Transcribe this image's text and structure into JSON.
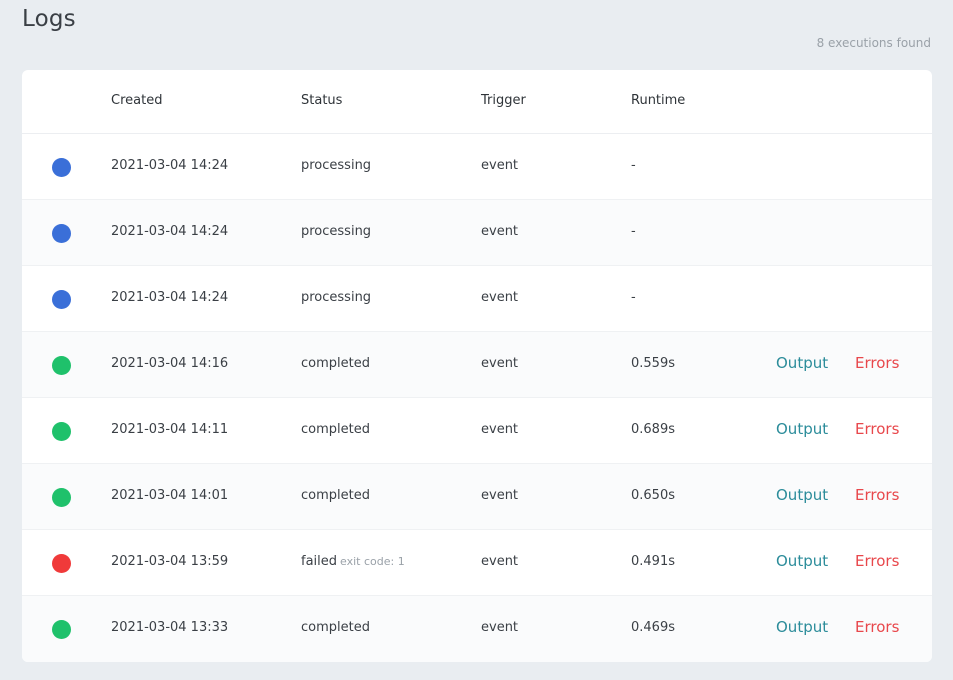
{
  "page": {
    "title": "Logs",
    "count_text": "8 executions found"
  },
  "table": {
    "headers": {
      "created": "Created",
      "status": "Status",
      "trigger": "Trigger",
      "runtime": "Runtime"
    },
    "rows": [
      {
        "status_color": "#3a6fd8",
        "created": "2021-03-04 14:24",
        "status": "processing",
        "exit": "",
        "trigger": "event",
        "runtime": "-",
        "output": "",
        "errors": ""
      },
      {
        "status_color": "#3a6fd8",
        "created": "2021-03-04 14:24",
        "status": "processing",
        "exit": "",
        "trigger": "event",
        "runtime": "-",
        "output": "",
        "errors": ""
      },
      {
        "status_color": "#3a6fd8",
        "created": "2021-03-04 14:24",
        "status": "processing",
        "exit": "",
        "trigger": "event",
        "runtime": "-",
        "output": "",
        "errors": ""
      },
      {
        "status_color": "#1fc16b",
        "created": "2021-03-04 14:16",
        "status": "completed",
        "exit": "",
        "trigger": "event",
        "runtime": "0.559s",
        "output": "Output",
        "errors": "Errors"
      },
      {
        "status_color": "#1fc16b",
        "created": "2021-03-04 14:11",
        "status": "completed",
        "exit": "",
        "trigger": "event",
        "runtime": "0.689s",
        "output": "Output",
        "errors": "Errors"
      },
      {
        "status_color": "#1fc16b",
        "created": "2021-03-04 14:01",
        "status": "completed",
        "exit": "",
        "trigger": "event",
        "runtime": "0.650s",
        "output": "Output",
        "errors": "Errors"
      },
      {
        "status_color": "#f03a3a",
        "created": "2021-03-04 13:59",
        "status": "failed",
        "exit": "exit code: 1",
        "trigger": "event",
        "runtime": "0.491s",
        "output": "Output",
        "errors": "Errors"
      },
      {
        "status_color": "#1fc16b",
        "created": "2021-03-04 13:33",
        "status": "completed",
        "exit": "",
        "trigger": "event",
        "runtime": "0.469s",
        "output": "Output",
        "errors": "Errors"
      }
    ]
  },
  "colors": {
    "output_link": "#2b8c9a",
    "errors_link": "#e8474b"
  }
}
